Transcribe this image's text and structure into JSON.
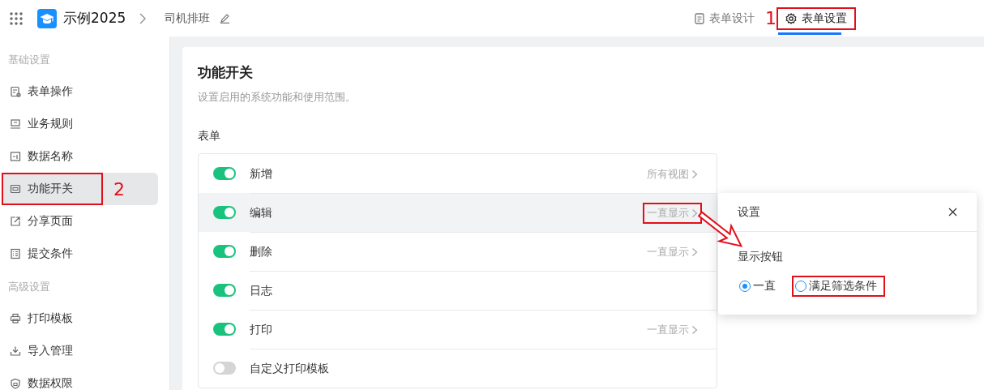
{
  "topbar": {
    "app_name": "示例2025",
    "breadcrumb": "司机排班",
    "tabs": [
      {
        "label": "表单设计",
        "selected": false,
        "highlighted": false
      },
      {
        "label": "表单设置",
        "selected": true,
        "highlighted": true,
        "callout": "1"
      }
    ]
  },
  "sidebar": {
    "groups": [
      {
        "title": "基础设置",
        "items": [
          {
            "label": "表单操作",
            "selected": false,
            "highlighted": false
          },
          {
            "label": "业务规则",
            "selected": false,
            "highlighted": false
          },
          {
            "label": "数据名称",
            "selected": false,
            "highlighted": false
          },
          {
            "label": "功能开关",
            "selected": true,
            "highlighted": true,
            "callout": "2"
          },
          {
            "label": "分享页面",
            "selected": false,
            "highlighted": false
          },
          {
            "label": "提交条件",
            "selected": false,
            "highlighted": false
          }
        ]
      },
      {
        "title": "高级设置",
        "items": [
          {
            "label": "打印模板",
            "selected": false,
            "highlighted": false
          },
          {
            "label": "导入管理",
            "selected": false,
            "highlighted": false
          },
          {
            "label": "数据权限",
            "selected": false,
            "highlighted": false
          }
        ]
      }
    ]
  },
  "panel": {
    "title": "功能开关",
    "description": "设置启用的系统功能和使用范围。",
    "section": "表单",
    "rows": [
      {
        "label": "新增",
        "on": true,
        "value": "所有视图",
        "selected": false,
        "highlighted": false
      },
      {
        "label": "编辑",
        "on": true,
        "value": "一直显示",
        "selected": true,
        "highlighted": true
      },
      {
        "label": "删除",
        "on": true,
        "value": "一直显示",
        "selected": false,
        "highlighted": false
      },
      {
        "label": "日志",
        "on": true,
        "selected": false
      },
      {
        "label": "打印",
        "on": true,
        "value": "一直显示",
        "selected": false,
        "highlighted": false
      },
      {
        "label": "自定义打印模板",
        "on": false,
        "selected": false
      }
    ]
  },
  "popup": {
    "title": "设置",
    "label": "显示按钮",
    "options": [
      {
        "label": "一直",
        "selected": true,
        "highlighted": false
      },
      {
        "label": "满足筛选条件",
        "selected": false,
        "highlighted": true
      }
    ]
  }
}
